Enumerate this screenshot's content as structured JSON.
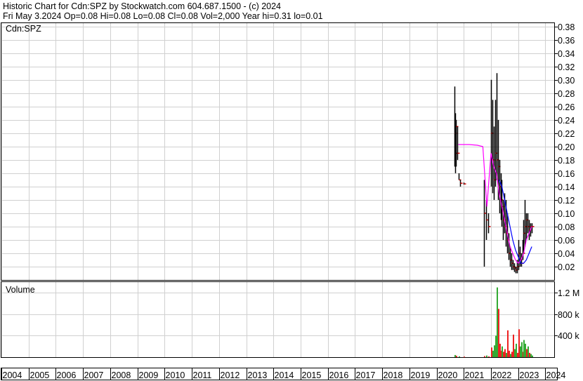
{
  "header": {
    "line1": "Historic Chart for Cdn:SPZ by Stockwatch.com 604.687.1500 - (c) 2024",
    "line2": "Fri May  3.2024   Op=0.08  Hi=0.08  Lo=0.08  Cl=0.08  Vol=2,000   Year hi=0.31  lo=0.01"
  },
  "colors": {
    "price_bar": "#000000",
    "close_tick": "#cc0000",
    "ma_short": "#ff00ff",
    "ma_long": "#0000ff",
    "vol_up": "#33aa33",
    "vol_down": "#ee2222",
    "grid": "#d0d0d0"
  },
  "chart_data": [
    {
      "type": "line",
      "panel": "price",
      "title": "Cdn:SPZ",
      "x_axis": {
        "type": "year",
        "ticks": [
          "2004",
          "2005",
          "2006",
          "2007",
          "2008",
          "2009",
          "2010",
          "2011",
          "2012",
          "2013",
          "2014",
          "2015",
          "2016",
          "2017",
          "2018",
          "2019",
          "2020",
          "2021",
          "2022",
          "2023",
          "2024"
        ],
        "range": [
          2004.0,
          2024.35
        ]
      },
      "y_axis": {
        "side": "right",
        "range": [
          0.0,
          0.385
        ],
        "ticks": [
          "0.02",
          "0.04",
          "0.06",
          "0.08",
          "0.10",
          "0.12",
          "0.14",
          "0.16",
          "0.18",
          "0.20",
          "0.22",
          "0.24",
          "0.26",
          "0.28",
          "0.30",
          "0.32",
          "0.34",
          "0.36",
          "0.38"
        ],
        "tick_values": [
          0.02,
          0.04,
          0.06,
          0.08,
          0.1,
          0.12,
          0.14,
          0.16,
          0.18,
          0.2,
          0.22,
          0.24,
          0.26,
          0.28,
          0.3,
          0.32,
          0.34,
          0.36,
          0.38
        ]
      },
      "grid": true,
      "price_bars": [
        [
          2020.65,
          0.17,
          0.29,
          0.22
        ],
        [
          2020.68,
          0.16,
          0.25,
          0.19
        ],
        [
          2020.72,
          0.17,
          0.24,
          0.23
        ],
        [
          2020.76,
          0.18,
          0.23,
          0.19
        ],
        [
          2020.8,
          0.15,
          0.16,
          0.15
        ],
        [
          2020.86,
          0.14,
          0.15,
          0.145
        ],
        [
          2021.0,
          0.143,
          0.146,
          0.144
        ],
        [
          2021.75,
          0.02,
          0.15,
          0.1
        ],
        [
          2021.82,
          0.06,
          0.12,
          0.09
        ],
        [
          2021.9,
          0.07,
          0.1,
          0.08
        ],
        [
          2022.0,
          0.14,
          0.3,
          0.22
        ],
        [
          2022.05,
          0.13,
          0.27,
          0.18
        ],
        [
          2022.1,
          0.12,
          0.23,
          0.15
        ],
        [
          2022.15,
          0.14,
          0.27,
          0.19
        ],
        [
          2022.2,
          0.15,
          0.31,
          0.18
        ],
        [
          2022.25,
          0.12,
          0.24,
          0.17
        ],
        [
          2022.3,
          0.1,
          0.18,
          0.14
        ],
        [
          2022.35,
          0.09,
          0.16,
          0.12
        ],
        [
          2022.4,
          0.08,
          0.15,
          0.11
        ],
        [
          2022.45,
          0.06,
          0.12,
          0.09
        ],
        [
          2022.5,
          0.07,
          0.13,
          0.08
        ],
        [
          2022.55,
          0.05,
          0.12,
          0.07
        ],
        [
          2022.6,
          0.04,
          0.1,
          0.06
        ],
        [
          2022.65,
          0.03,
          0.07,
          0.04
        ],
        [
          2022.7,
          0.02,
          0.05,
          0.03
        ],
        [
          2022.75,
          0.015,
          0.04,
          0.025
        ],
        [
          2022.8,
          0.015,
          0.03,
          0.02
        ],
        [
          2022.85,
          0.012,
          0.025,
          0.018
        ],
        [
          2022.9,
          0.01,
          0.02,
          0.015
        ],
        [
          2022.95,
          0.01,
          0.03,
          0.02
        ],
        [
          2023.0,
          0.015,
          0.06,
          0.04
        ],
        [
          2023.05,
          0.02,
          0.05,
          0.03
        ],
        [
          2023.1,
          0.02,
          0.04,
          0.025
        ],
        [
          2023.15,
          0.03,
          0.06,
          0.04
        ],
        [
          2023.2,
          0.04,
          0.09,
          0.07
        ],
        [
          2023.25,
          0.05,
          0.12,
          0.08
        ],
        [
          2023.3,
          0.06,
          0.1,
          0.09
        ],
        [
          2023.35,
          0.07,
          0.1,
          0.08
        ],
        [
          2023.4,
          0.06,
          0.09,
          0.075
        ],
        [
          2023.45,
          0.065,
          0.085,
          0.08
        ],
        [
          2023.5,
          0.07,
          0.085,
          0.08
        ]
      ],
      "series": [
        {
          "name": "",
          "color": "#ff00ff",
          "x": [
            2020.8,
            2021.0,
            2021.2,
            2021.5,
            2021.7,
            2021.85,
            2022.0,
            2022.1,
            2022.2,
            2022.3,
            2022.4,
            2022.5,
            2022.6,
            2022.7,
            2022.8,
            2022.9,
            2023.0,
            2023.1,
            2023.2,
            2023.3,
            2023.4,
            2023.5
          ],
          "y": [
            0.203,
            0.203,
            0.203,
            0.202,
            0.2,
            0.11,
            0.19,
            0.17,
            0.16,
            0.13,
            0.11,
            0.09,
            0.07,
            0.05,
            0.04,
            0.03,
            0.025,
            0.03,
            0.04,
            0.06,
            0.07,
            0.08
          ]
        },
        {
          "name": "",
          "color": "#0000ff",
          "x": [
            2022.3,
            2022.4,
            2022.5,
            2022.6,
            2022.7,
            2022.8,
            2022.9,
            2023.0,
            2023.1,
            2023.2,
            2023.3,
            2023.4,
            2023.5
          ],
          "y": [
            0.15,
            0.14,
            0.12,
            0.1,
            0.08,
            0.06,
            0.045,
            0.035,
            0.025,
            0.025,
            0.03,
            0.04,
            0.05
          ]
        }
      ]
    },
    {
      "type": "bar",
      "panel": "volume",
      "title": "Volume",
      "y_axis": {
        "side": "right",
        "range": [
          0,
          1400000
        ],
        "ticks": [
          "400 k",
          "800 k",
          "1.2 M"
        ],
        "tick_values": [
          400000,
          800000,
          1200000
        ]
      },
      "bars": [
        [
          2020.65,
          40000,
          "up"
        ],
        [
          2020.72,
          25000,
          "down"
        ],
        [
          2020.8,
          15000,
          "up"
        ],
        [
          2021.0,
          10000,
          "down"
        ],
        [
          2021.75,
          20000,
          "down"
        ],
        [
          2021.82,
          30000,
          "up"
        ],
        [
          2021.9,
          15000,
          "down"
        ],
        [
          2022.0,
          180000,
          "down"
        ],
        [
          2022.05,
          120000,
          "up"
        ],
        [
          2022.1,
          220000,
          "up"
        ],
        [
          2022.15,
          400000,
          "up"
        ],
        [
          2022.2,
          1300000,
          "up"
        ],
        [
          2022.25,
          900000,
          "down"
        ],
        [
          2022.3,
          250000,
          "down"
        ],
        [
          2022.35,
          120000,
          "down"
        ],
        [
          2022.4,
          200000,
          "up"
        ],
        [
          2022.45,
          100000,
          "down"
        ],
        [
          2022.5,
          150000,
          "down"
        ],
        [
          2022.55,
          80000,
          "up"
        ],
        [
          2022.6,
          500000,
          "down"
        ],
        [
          2022.65,
          120000,
          "down"
        ],
        [
          2022.7,
          60000,
          "up"
        ],
        [
          2022.75,
          100000,
          "down"
        ],
        [
          2022.8,
          420000,
          "down"
        ],
        [
          2022.85,
          150000,
          "up"
        ],
        [
          2022.9,
          250000,
          "up"
        ],
        [
          2022.95,
          80000,
          "down"
        ],
        [
          2023.0,
          520000,
          "down"
        ],
        [
          2023.05,
          200000,
          "up"
        ],
        [
          2023.1,
          280000,
          "up"
        ],
        [
          2023.15,
          100000,
          "down"
        ],
        [
          2023.2,
          320000,
          "up"
        ],
        [
          2023.25,
          250000,
          "up"
        ],
        [
          2023.3,
          150000,
          "down"
        ],
        [
          2023.35,
          200000,
          "up"
        ],
        [
          2023.4,
          80000,
          "down"
        ],
        [
          2023.45,
          60000,
          "up"
        ],
        [
          2023.5,
          30000,
          "up"
        ]
      ]
    }
  ]
}
